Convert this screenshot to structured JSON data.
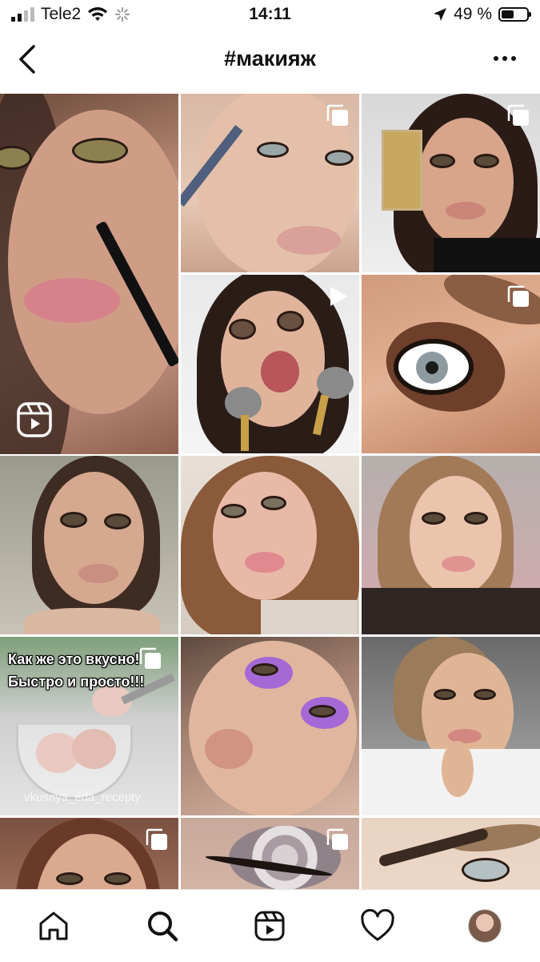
{
  "status_bar": {
    "carrier": "Tele2",
    "time": "14:11",
    "battery_percent": "49 %",
    "battery_level": 0.49
  },
  "header": {
    "title": "#макияж",
    "back_icon": "chevron-left-icon",
    "more_icon": "more-horizontal-icon"
  },
  "grid": {
    "posts": [
      {
        "type": "reel"
      },
      {
        "type": "carousel"
      },
      {
        "type": "carousel"
      },
      {
        "type": "video"
      },
      {
        "type": "carousel"
      },
      {
        "type": "photo"
      },
      {
        "type": "photo"
      },
      {
        "type": "photo"
      },
      {
        "type": "carousel",
        "caption_line1": "Как же это вкусно!",
        "caption_line2": "Быстро и просто!!!",
        "watermark": "vkusnya_eda_recepty"
      },
      {
        "type": "photo"
      },
      {
        "type": "photo"
      },
      {
        "type": "carousel"
      },
      {
        "type": "carousel"
      },
      {
        "type": "photo"
      }
    ]
  },
  "tab_bar": {
    "items": [
      "home-icon",
      "search-icon",
      "reels-icon",
      "heart-icon",
      "profile-avatar"
    ],
    "active": "search-icon"
  }
}
